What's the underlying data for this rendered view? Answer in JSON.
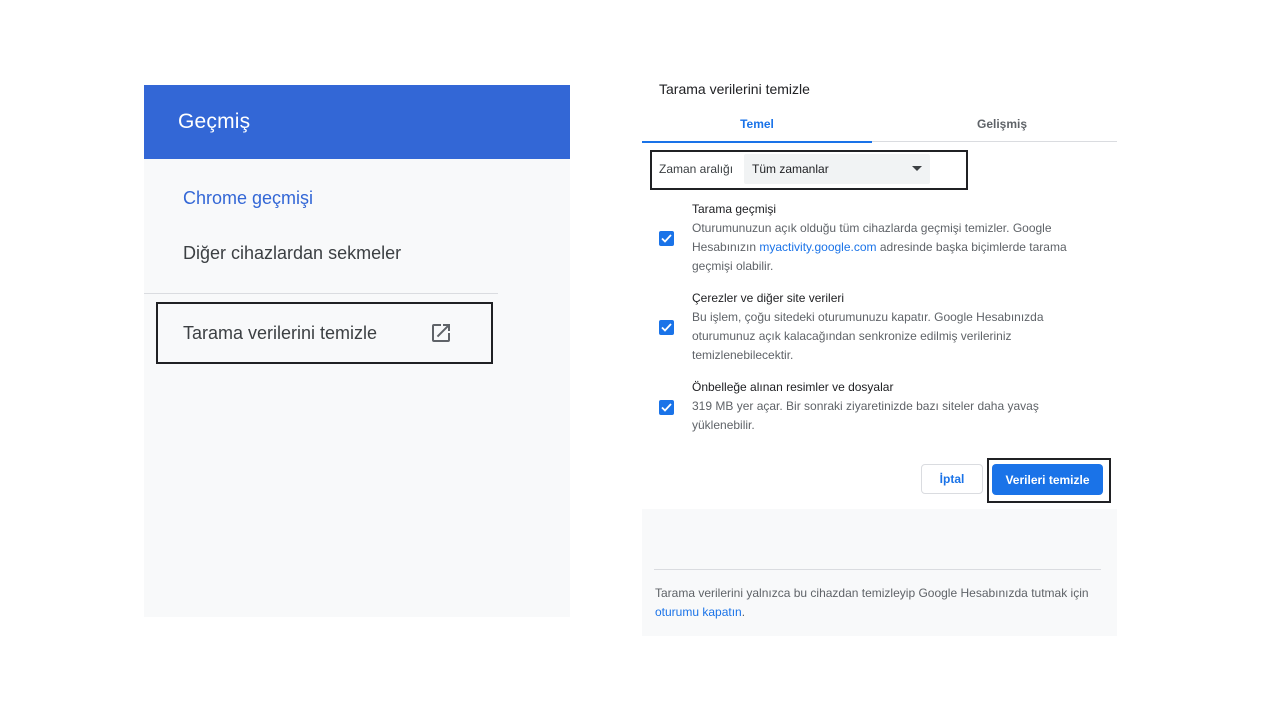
{
  "history_page": {
    "header_title": "Geçmiş",
    "items": [
      {
        "label": "Chrome geçmişi"
      },
      {
        "label": "Diğer cihazlardan sekmeler"
      }
    ],
    "clear_data_label": "Tarama verilerini temizle",
    "clear_data_icon": "external-link-icon"
  },
  "dialog": {
    "title": "Tarama verilerini temizle",
    "tabs": [
      {
        "label": "Temel"
      },
      {
        "label": "Gelişmiş"
      }
    ],
    "time_range": {
      "label": "Zaman aralığı",
      "value": "Tüm zamanlar"
    },
    "options": [
      {
        "title": "Tarama geçmişi",
        "desc_pre": "Oturumunuzun açık olduğu tüm cihazlarda geçmişi temizler. Google Hesabınızın ",
        "desc_link": "myactivity.google.com",
        "desc_post": " adresinde başka biçimlerde tarama geçmişi olabilir.",
        "checked": true
      },
      {
        "title": "Çerezler ve diğer site verileri",
        "desc": "Bu işlem, çoğu sitedeki oturumunuzu kapatır. Google Hesabınızda oturumunuz açık kalacağından senkronize edilmiş verileriniz temizlenebilecektir.",
        "checked": true
      },
      {
        "title": "Önbelleğe alınan resimler ve dosyalar",
        "desc": "319 MB yer açar. Bir sonraki ziyaretinizde bazı siteler daha yavaş yüklenebilir.",
        "checked": true
      }
    ],
    "cancel_label": "İptal",
    "confirm_label": "Verileri temizle",
    "footer_text": "Tarama verilerini yalnızca bu cihazdan temizleyip Google Hesabınızda tutmak için ",
    "footer_link": "oturumu kapatın",
    "footer_end": "."
  },
  "colors": {
    "header_blue": "#3367d6",
    "accent_blue": "#1a73e8"
  }
}
